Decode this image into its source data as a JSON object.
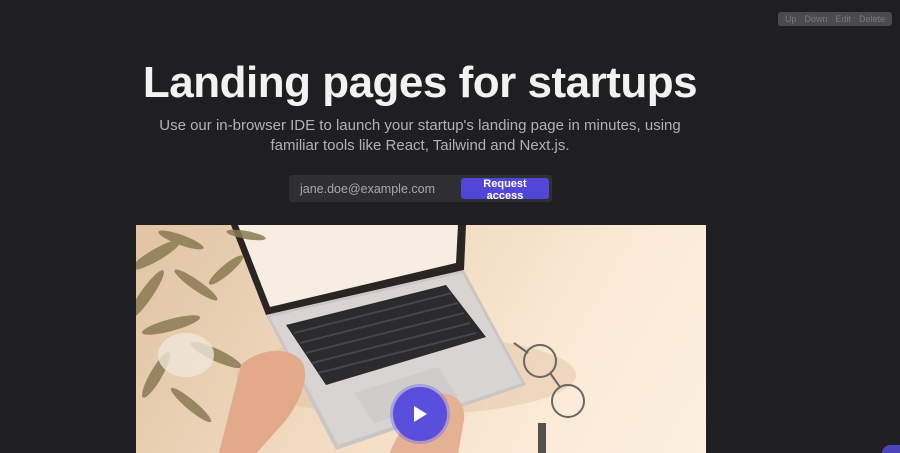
{
  "editor_toolbar": {
    "up_label": "Up",
    "down_label": "Down",
    "edit_label": "Edit",
    "delete_label": "Delete"
  },
  "hero": {
    "title": "Landing pages for startups",
    "subtitle": "Use our in-browser IDE to launch your startup's landing page in minutes, using familiar tools like React, Tailwind and Next.js."
  },
  "signup": {
    "email_placeholder": "jane.doe@example.com",
    "button_label": "Request access"
  },
  "video": {
    "play_icon": "play-icon"
  },
  "colors": {
    "background": "#1f1e21",
    "accent": "#5146d8",
    "title": "#f2f2f3",
    "subtitle": "#b2b2b6"
  }
}
